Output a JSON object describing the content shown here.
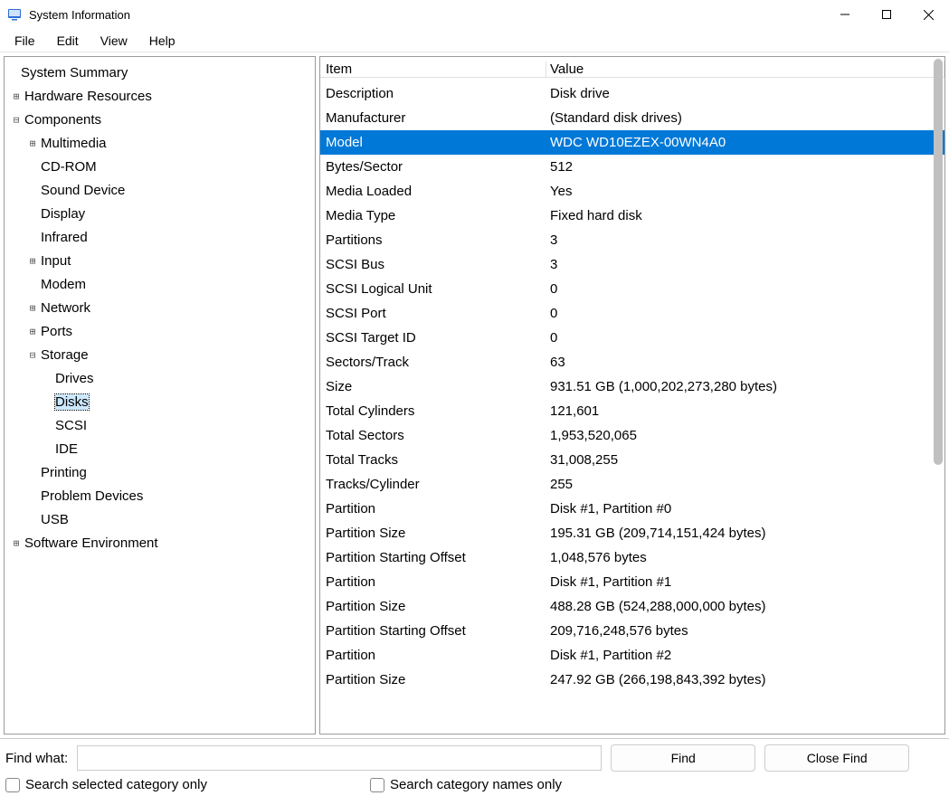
{
  "window": {
    "title": "System Information"
  },
  "menus": {
    "file": "File",
    "edit": "Edit",
    "view": "View",
    "help": "Help"
  },
  "tree": {
    "root": "System Summary",
    "hardware": "Hardware Resources",
    "components": "Components",
    "multimedia": "Multimedia",
    "cdrom": "CD-ROM",
    "sound": "Sound Device",
    "display": "Display",
    "infrared": "Infrared",
    "input": "Input",
    "modem": "Modem",
    "network": "Network",
    "ports": "Ports",
    "storage": "Storage",
    "drives": "Drives",
    "disks": "Disks",
    "scsi": "SCSI",
    "ide": "IDE",
    "printing": "Printing",
    "problem": "Problem Devices",
    "usb": "USB",
    "software": "Software Environment"
  },
  "grid": {
    "header_item": "Item",
    "header_value": "Value",
    "rows": [
      {
        "item": "Description",
        "value": "Disk drive"
      },
      {
        "item": "Manufacturer",
        "value": "(Standard disk drives)"
      },
      {
        "item": "Model",
        "value": "WDC WD10EZEX-00WN4A0",
        "selected": true
      },
      {
        "item": "Bytes/Sector",
        "value": "512"
      },
      {
        "item": "Media Loaded",
        "value": "Yes"
      },
      {
        "item": "Media Type",
        "value": "Fixed hard disk"
      },
      {
        "item": "Partitions",
        "value": "3"
      },
      {
        "item": "SCSI Bus",
        "value": "3"
      },
      {
        "item": "SCSI Logical Unit",
        "value": "0"
      },
      {
        "item": "SCSI Port",
        "value": "0"
      },
      {
        "item": "SCSI Target ID",
        "value": "0"
      },
      {
        "item": "Sectors/Track",
        "value": "63"
      },
      {
        "item": "Size",
        "value": "931.51 GB (1,000,202,273,280 bytes)"
      },
      {
        "item": "Total Cylinders",
        "value": "121,601"
      },
      {
        "item": "Total Sectors",
        "value": "1,953,520,065"
      },
      {
        "item": "Total Tracks",
        "value": "31,008,255"
      },
      {
        "item": "Tracks/Cylinder",
        "value": "255"
      },
      {
        "item": "Partition",
        "value": "Disk #1, Partition #0"
      },
      {
        "item": "Partition Size",
        "value": "195.31 GB (209,714,151,424 bytes)"
      },
      {
        "item": "Partition Starting Offset",
        "value": "1,048,576 bytes"
      },
      {
        "item": "Partition",
        "value": "Disk #1, Partition #1"
      },
      {
        "item": "Partition Size",
        "value": "488.28 GB (524,288,000,000 bytes)"
      },
      {
        "item": "Partition Starting Offset",
        "value": "209,716,248,576 bytes"
      },
      {
        "item": "Partition",
        "value": "Disk #1, Partition #2"
      },
      {
        "item": "Partition Size",
        "value": "247.92 GB (266,198,843,392 bytes)"
      }
    ]
  },
  "find": {
    "label": "Find what:",
    "value": "",
    "find_btn": "Find",
    "close_btn": "Close Find",
    "opt1": "Search selected category only",
    "opt2": "Search category names only"
  }
}
